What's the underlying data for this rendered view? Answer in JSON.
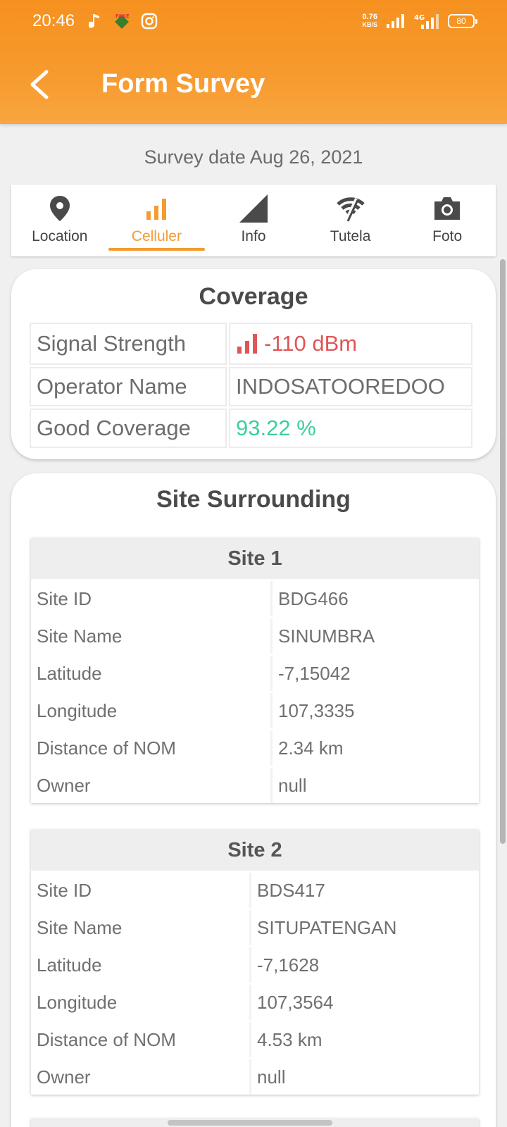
{
  "status_bar": {
    "time": "20:46",
    "net_speed_value": "0.76",
    "net_speed_unit": "KB/S",
    "battery": "80"
  },
  "header": {
    "title": "Form Survey",
    "back_icon": "chevron-left-icon",
    "background_color": "#f6911f"
  },
  "survey": {
    "date_label": "Survey date Aug 26, 2021"
  },
  "tabs": [
    {
      "label": "Location",
      "icon": "map-pin-icon",
      "active": false
    },
    {
      "label": "Celluler",
      "icon": "signal-bars-icon",
      "active": true
    },
    {
      "label": "Info",
      "icon": "triangle-signal-icon",
      "active": false
    },
    {
      "label": "Tutela",
      "icon": "wifi-slash-icon",
      "active": false
    },
    {
      "label": "Foto",
      "icon": "camera-icon",
      "active": false
    }
  ],
  "accent_color": "#f39c34",
  "coverage": {
    "title": "Coverage",
    "rows": [
      {
        "key": "Signal Strength",
        "value": "-110 dBm"
      },
      {
        "key": "Operator Name",
        "value": "INDOSATOOREDOO"
      },
      {
        "key": "Good Coverage",
        "value": "93.22 %"
      }
    ],
    "signal_color": "#e05656",
    "good_color": "#3fcf9a"
  },
  "site_surrounding": {
    "title": "Site Surrounding",
    "sites": [
      {
        "name": "Site 1",
        "rows": [
          {
            "key": "Site ID",
            "value": "BDG466"
          },
          {
            "key": "Site Name",
            "value": "SINUMBRA"
          },
          {
            "key": "Latitude",
            "value": "-7,15042"
          },
          {
            "key": "Longitude",
            "value": "107,3335"
          },
          {
            "key": "Distance of NOM",
            "value": "2.34 km"
          },
          {
            "key": "Owner",
            "value": "null"
          }
        ]
      },
      {
        "name": "Site 2",
        "rows": [
          {
            "key": "Site ID",
            "value": "BDS417"
          },
          {
            "key": "Site Name",
            "value": "SITUPATENGAN"
          },
          {
            "key": "Latitude",
            "value": "-7,1628"
          },
          {
            "key": "Longitude",
            "value": "107,3564"
          },
          {
            "key": "Distance of NOM",
            "value": "4.53 km"
          },
          {
            "key": "Owner",
            "value": "null"
          }
        ]
      }
    ]
  }
}
